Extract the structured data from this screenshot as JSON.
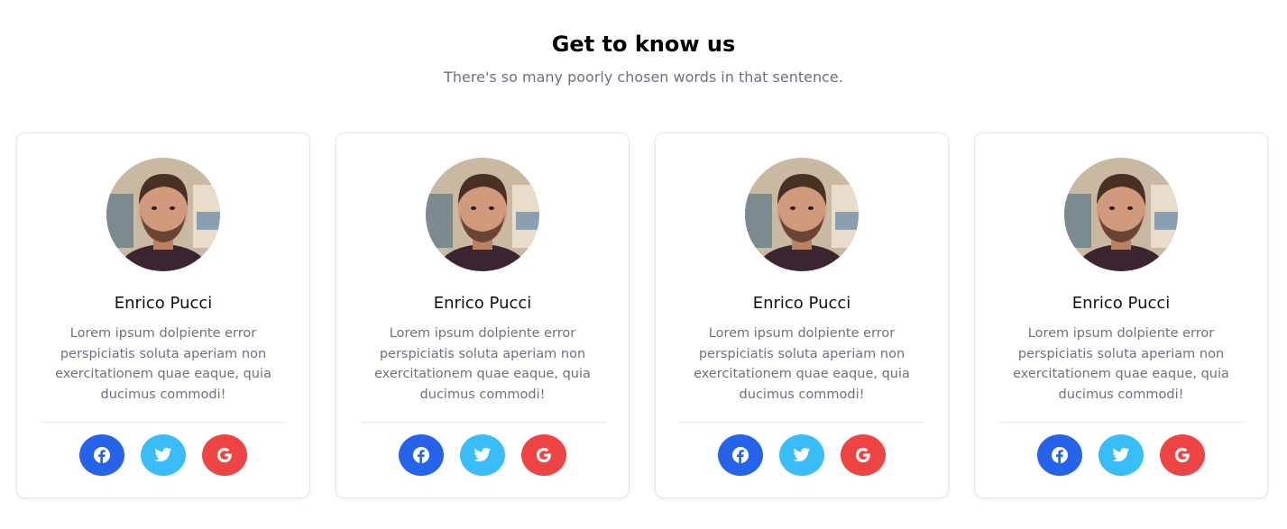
{
  "header": {
    "title": "Get to know us",
    "subtitle": "There's so many poorly chosen words in that sentence."
  },
  "members": [
    {
      "name": "Enrico Pucci",
      "bio": "Lorem ipsum dolpiente error perspiciatis soluta aperiam non exercitationem quae eaque, quia ducimus commodi!",
      "socials": [
        {
          "icon": "facebook-icon",
          "color": "#2563eb"
        },
        {
          "icon": "twitter-icon",
          "color": "#38bdf8"
        },
        {
          "icon": "google-icon",
          "color": "#ef4444"
        }
      ]
    },
    {
      "name": "Enrico Pucci",
      "bio": "Lorem ipsum dolpiente error perspiciatis soluta aperiam non exercitationem quae eaque, quia ducimus commodi!",
      "socials": [
        {
          "icon": "facebook-icon",
          "color": "#2563eb"
        },
        {
          "icon": "twitter-icon",
          "color": "#38bdf8"
        },
        {
          "icon": "google-icon",
          "color": "#ef4444"
        }
      ]
    },
    {
      "name": "Enrico Pucci",
      "bio": "Lorem ipsum dolpiente error perspiciatis soluta aperiam non exercitationem quae eaque, quia ducimus commodi!",
      "socials": [
        {
          "icon": "facebook-icon",
          "color": "#2563eb"
        },
        {
          "icon": "twitter-icon",
          "color": "#38bdf8"
        },
        {
          "icon": "google-icon",
          "color": "#ef4444"
        }
      ]
    },
    {
      "name": "Enrico Pucci",
      "bio": "Lorem ipsum dolpiente error perspiciatis soluta aperiam non exercitationem quae eaque, quia ducimus commodi!",
      "socials": [
        {
          "icon": "facebook-icon",
          "color": "#2563eb"
        },
        {
          "icon": "twitter-icon",
          "color": "#38bdf8"
        },
        {
          "icon": "google-icon",
          "color": "#ef4444"
        }
      ]
    }
  ]
}
